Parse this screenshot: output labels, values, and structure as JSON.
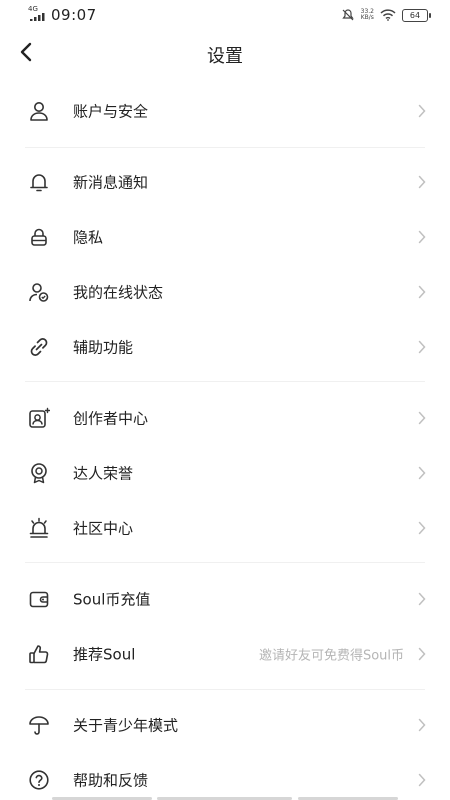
{
  "status_bar": {
    "network": "4G",
    "time": "09:07",
    "speed_value": "33.2",
    "speed_unit": "KB/s",
    "battery": "64"
  },
  "header": {
    "title": "设置"
  },
  "groups": [
    {
      "items": [
        {
          "label": "账户与安全",
          "icon": "user-icon"
        }
      ]
    },
    {
      "items": [
        {
          "label": "新消息通知",
          "icon": "bell-icon"
        },
        {
          "label": "隐私",
          "icon": "lock-icon"
        },
        {
          "label": "我的在线状态",
          "icon": "online-status-icon"
        },
        {
          "label": "辅助功能",
          "icon": "link-icon"
        }
      ]
    },
    {
      "items": [
        {
          "label": "创作者中心",
          "icon": "creator-icon"
        },
        {
          "label": "达人荣誉",
          "icon": "badge-icon"
        },
        {
          "label": "社区中心",
          "icon": "community-icon"
        }
      ]
    },
    {
      "items": [
        {
          "label": "Soul币充值",
          "icon": "wallet-icon"
        },
        {
          "label": "推荐Soul",
          "hint": "邀请好友可免费得Soul币",
          "icon": "thumbs-up-icon"
        }
      ]
    },
    {
      "items": [
        {
          "label": "关于青少年模式",
          "icon": "umbrella-icon"
        },
        {
          "label": "帮助和反馈",
          "icon": "help-icon"
        }
      ]
    }
  ],
  "colors": {
    "text": "#222222",
    "hint": "#b5b5b5",
    "chevron": "#c0c0c0",
    "divider": "#f0f0f0"
  }
}
